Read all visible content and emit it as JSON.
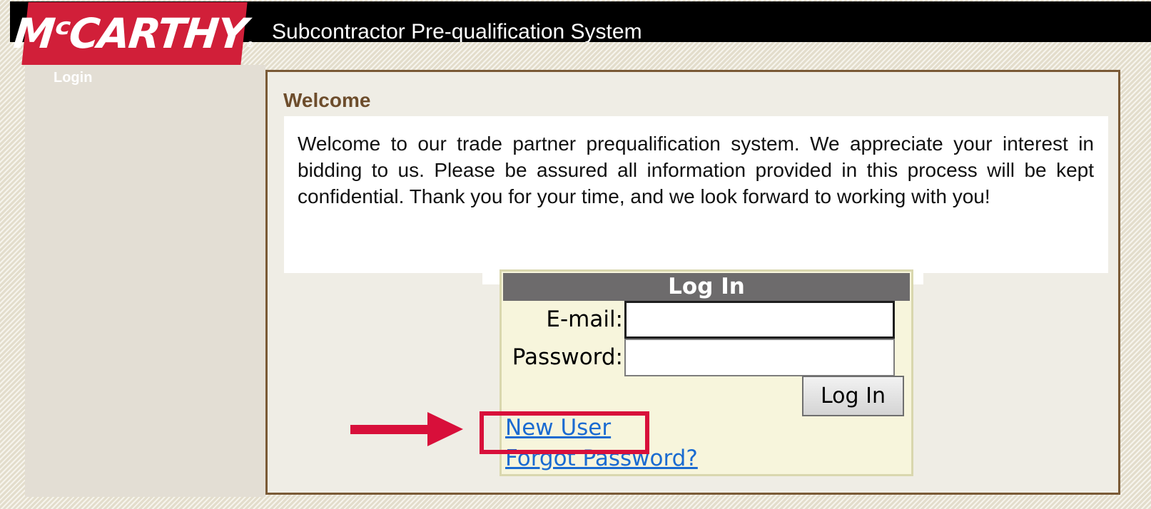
{
  "brand": {
    "logo_text": "MᶜCARTHY",
    "logo_mark": "®",
    "app_title": "Subcontractor Pre-qualification System",
    "logo_color": "#d11f39"
  },
  "sidebar": {
    "items": [
      {
        "label": "Login"
      }
    ]
  },
  "welcome": {
    "heading": "Welcome",
    "text": "Welcome to our trade partner prequalification system. We appreciate your interest in bidding to us. Please be assured all information provided in this process will be kept confidential. Thank you for your time, and we look forward to working with you!"
  },
  "login": {
    "title": "Log In",
    "email_label": "E-mail:",
    "email_value": "",
    "password_label": "Password:",
    "password_value": "",
    "submit_label": "Log In",
    "new_user_label": "New User",
    "forgot_password_label": "Forgot Password?"
  },
  "annotation": {
    "arrow_icon": "right-arrow-icon",
    "color": "#d80f3a"
  }
}
